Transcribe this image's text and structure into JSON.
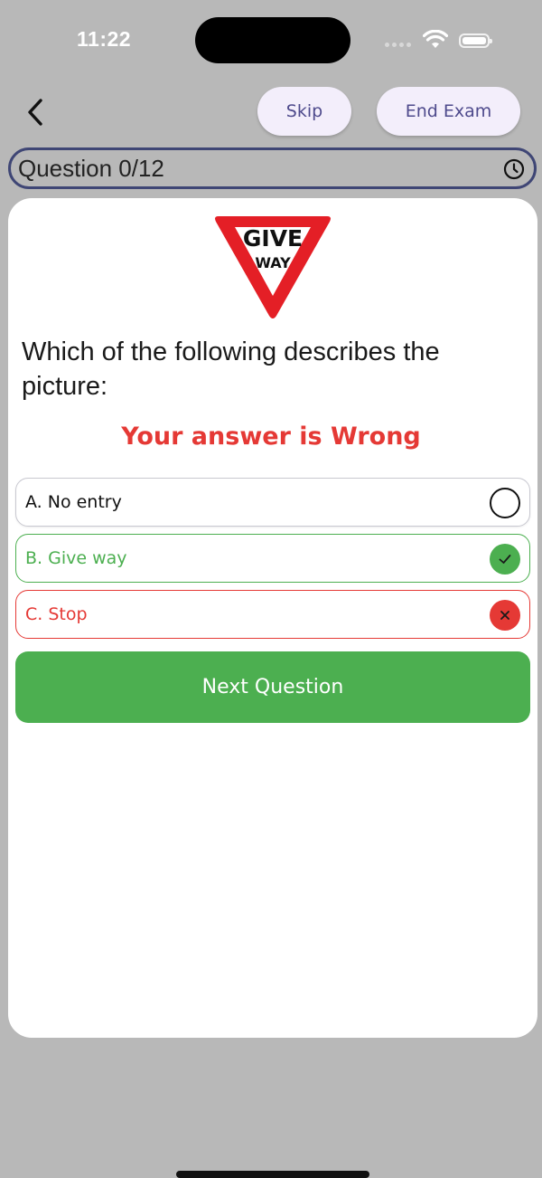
{
  "status_bar": {
    "time": "11:22"
  },
  "header": {
    "skip_label": "Skip",
    "end_exam_label": "End Exam"
  },
  "progress": {
    "question_label": "Question 0/12"
  },
  "question": {
    "sign_line1": "GIVE",
    "sign_line2": "WAY",
    "text": "Which of the following describes the picture:",
    "result": "Your answer is Wrong"
  },
  "options": [
    {
      "label": "A. No entry",
      "state": "unselected"
    },
    {
      "label": "B. Give way",
      "state": "correct"
    },
    {
      "label": "C. Stop",
      "state": "wrong"
    }
  ],
  "next_button": {
    "label": "Next Question"
  },
  "colors": {
    "correct": "#4caf50",
    "wrong": "#e53935",
    "accent": "#4e4a8c",
    "background": "#b8b8b8"
  },
  "icons": {
    "back": "chevron-left-icon",
    "clock": "clock-icon",
    "check": "checkmark-icon",
    "cross": "close-icon"
  }
}
